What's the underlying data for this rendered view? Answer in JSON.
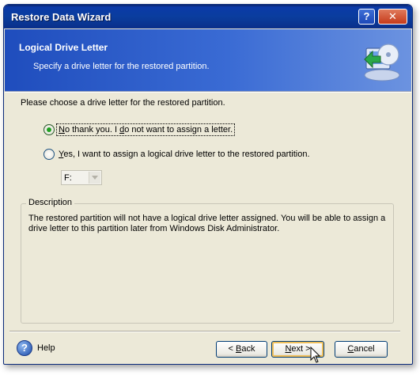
{
  "window": {
    "title": "Restore Data Wizard",
    "help_button": "?",
    "close_button": "✕"
  },
  "header": {
    "title": "Logical Drive Letter",
    "subtitle": "Specify a drive letter for the restored partition."
  },
  "prompt": "Please choose a drive letter for the restored partition.",
  "options": [
    {
      "label_prefix": "N",
      "label_rest": "o thank you. I ",
      "label_u2": "d",
      "label_rest2": "o not want to assign a letter.",
      "selected": true
    },
    {
      "label_prefix": "Y",
      "label_rest": "es, I want to assign a logical drive letter to the restored partition.",
      "selected": false
    }
  ],
  "drive_select": {
    "value": "F:",
    "enabled": false
  },
  "description": {
    "legend": "Description",
    "text": "The restored partition will not have a logical drive letter assigned. You will be able to assign a drive letter to this partition later from Windows Disk Administrator."
  },
  "footer": {
    "help_label": "Help",
    "help_icon_glyph": "?",
    "back_label_pre": "< ",
    "back_label_u": "B",
    "back_label_post": "ack",
    "next_label_pre": "",
    "next_label_u": "N",
    "next_label_post": "ext >",
    "cancel_label_pre": "",
    "cancel_label_u": "C",
    "cancel_label_post": "ancel"
  },
  "colors": {
    "title_bar": "#0a3d9e",
    "header_gradient_start": "#1f4dbd",
    "dialog_bg": "#ece9d8",
    "radio_selected": "#21a121"
  }
}
